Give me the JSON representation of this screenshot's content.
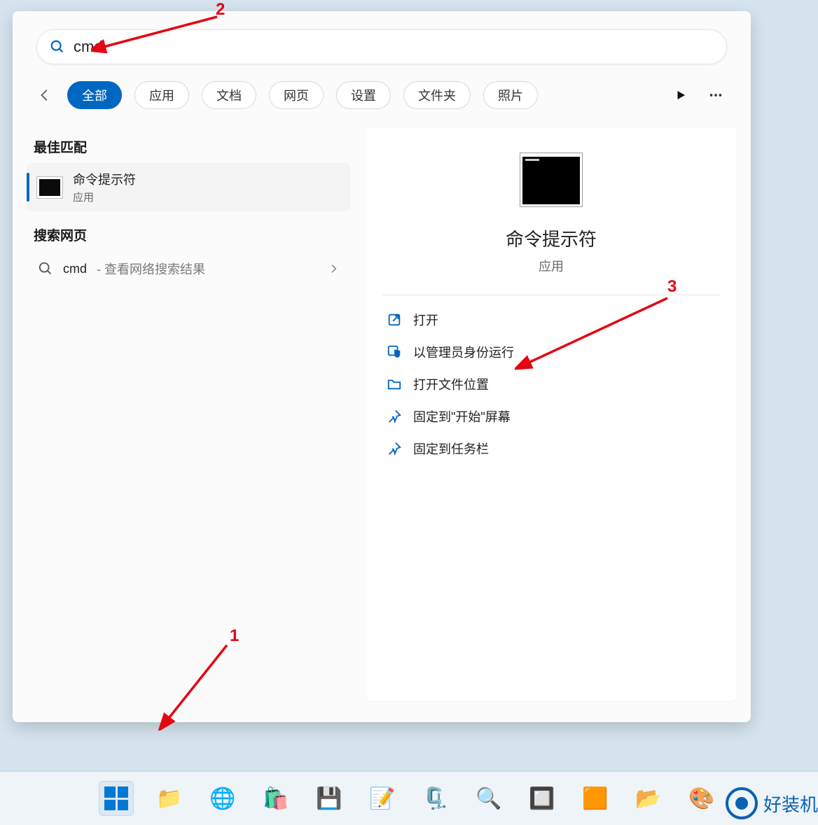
{
  "search": {
    "value": "cmd"
  },
  "filters": {
    "items": [
      {
        "label": "全部",
        "active": true
      },
      {
        "label": "应用",
        "active": false
      },
      {
        "label": "文档",
        "active": false
      },
      {
        "label": "网页",
        "active": false
      },
      {
        "label": "设置",
        "active": false
      },
      {
        "label": "文件夹",
        "active": false
      },
      {
        "label": "照片",
        "active": false
      }
    ]
  },
  "left": {
    "best_match_heading": "最佳匹配",
    "result": {
      "title": "命令提示符",
      "subtitle": "应用"
    },
    "search_web_heading": "搜索网页",
    "web_result": {
      "term": "cmd",
      "suffix": " - 查看网络搜索结果"
    }
  },
  "preview": {
    "title": "命令提示符",
    "subtitle": "应用",
    "actions": [
      {
        "label": "打开",
        "icon": "open"
      },
      {
        "label": "以管理员身份运行",
        "icon": "admin"
      },
      {
        "label": "打开文件位置",
        "icon": "folder"
      },
      {
        "label": "固定到\"开始\"屏幕",
        "icon": "pin"
      },
      {
        "label": "固定到任务栏",
        "icon": "pin"
      }
    ]
  },
  "annotations": {
    "n1": "1",
    "n2": "2",
    "n3": "3"
  },
  "watermark": {
    "text": "好装机"
  }
}
